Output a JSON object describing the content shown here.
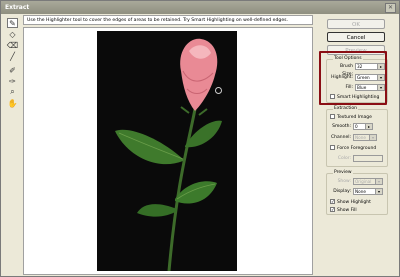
{
  "window": {
    "title": "Extract",
    "close_icon": "close-icon"
  },
  "hint_text": "Use the Highlighter tool to cover the edges of areas to be retained. Try Smart Highlighting on well-defined edges.",
  "tools": [
    "highlighter-icon",
    "fill-icon",
    "eraser-icon",
    "eyedropper-icon",
    "cleanup-icon",
    "edge-touchup-icon",
    "zoom-icon",
    "hand-icon"
  ],
  "buttons": {
    "ok": "OK",
    "cancel": "Cancel",
    "preview": "Preview"
  },
  "tool_options": {
    "title": "Tool Options",
    "brush_size_label": "Brush Size:",
    "brush_size_value": "32",
    "highlight_label": "Highlight:",
    "highlight_value": "Green",
    "fill_label": "Fill:",
    "fill_value": "Blue",
    "smart_highlighting": "Smart Highlighting"
  },
  "extraction": {
    "title": "Extraction",
    "textured_image": "Textured Image",
    "smooth_label": "Smooth:",
    "smooth_value": "0",
    "channel_label": "Channel:",
    "channel_value": "None",
    "force_foreground": "Force Foreground",
    "color_label": "Color:"
  },
  "preview_group": {
    "title": "Preview",
    "show_label": "Show:",
    "show_value": "Original",
    "display_label": "Display:",
    "display_value": "None",
    "show_highlight": "Show Highlight",
    "show_fill": "Show Fill",
    "show_highlight_checked": true,
    "show_fill_checked": true
  },
  "colors": {
    "highlight_box": "#8a0e14",
    "photo_bg": "#0a0a0a"
  }
}
